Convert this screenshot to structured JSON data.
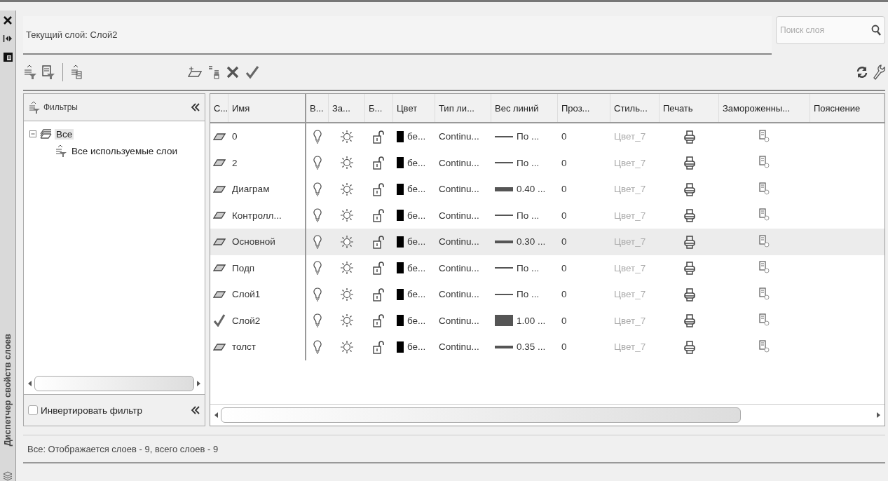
{
  "side_strip": {
    "title": "Диспетчер свойств слоев"
  },
  "current_layer": "Текущий слой: Слой2",
  "search": {
    "placeholder": "Поиск слоя"
  },
  "filters": {
    "title": "Фильтры",
    "tree": [
      {
        "label": "Все",
        "expanded": true,
        "selected": true,
        "children": [
          {
            "label": "Все используемые слои",
            "selected": false
          }
        ]
      }
    ],
    "invert": {
      "label": "Инвертировать фильтр",
      "checked": false
    }
  },
  "table": {
    "columns": [
      "С...",
      "Имя",
      "В...",
      "За...",
      "Б...",
      "Цвет",
      "Тип ли...",
      "Вес линий",
      "Проз...",
      "Стиль...",
      "Печать",
      "Замороженны...",
      "Пояснение"
    ],
    "rows": [
      {
        "current": false,
        "selected": false,
        "name": "0",
        "on": true,
        "frozen": false,
        "locked": false,
        "color": "#000000",
        "color_name": "бе...",
        "linetype": "Continu...",
        "kind": "thin",
        "lineweight": "По ...",
        "transparency": "0",
        "plot_style": "Цвет_7",
        "plot": true
      },
      {
        "current": false,
        "selected": false,
        "name": "2",
        "on": true,
        "frozen": false,
        "locked": false,
        "color": "#000000",
        "color_name": "бе...",
        "linetype": "Continu...",
        "kind": "thin",
        "lineweight": "По ...",
        "transparency": "0",
        "plot_style": "Цвет_7",
        "plot": true
      },
      {
        "current": false,
        "selected": false,
        "name": "Диаграм",
        "on": true,
        "frozen": false,
        "locked": false,
        "color": "#000000",
        "color_name": "бе...",
        "linetype": "Continu...",
        "kind": "bold",
        "lineweight": "0.40 ...",
        "transparency": "0",
        "plot_style": "Цвет_7",
        "plot": true
      },
      {
        "current": false,
        "selected": false,
        "name": "Контролл...",
        "on": true,
        "frozen": false,
        "locked": false,
        "color": "#000000",
        "color_name": "бе...",
        "linetype": "Continu...",
        "kind": "thin",
        "lineweight": "По ...",
        "transparency": "0",
        "plot_style": "Цвет_7",
        "plot": true
      },
      {
        "current": false,
        "selected": true,
        "name": "Основной",
        "on": true,
        "frozen": false,
        "locked": false,
        "color": "#000000",
        "color_name": "бе...",
        "linetype": "Continu...",
        "kind": "medium",
        "lineweight": "0.30 ...",
        "transparency": "0",
        "plot_style": "Цвет_7",
        "plot": true
      },
      {
        "current": false,
        "selected": false,
        "name": "Подп",
        "on": true,
        "frozen": false,
        "locked": false,
        "color": "#000000",
        "color_name": "бе...",
        "linetype": "Continu...",
        "kind": "thin",
        "lineweight": "По ...",
        "transparency": "0",
        "plot_style": "Цвет_7",
        "plot": true
      },
      {
        "current": false,
        "selected": false,
        "name": "Слой1",
        "on": true,
        "frozen": false,
        "locked": false,
        "color": "#000000",
        "color_name": "бе...",
        "linetype": "Continu...",
        "kind": "thin",
        "lineweight": "По ...",
        "transparency": "0",
        "plot_style": "Цвет_7",
        "plot": true
      },
      {
        "current": true,
        "selected": false,
        "name": "Слой2",
        "on": true,
        "frozen": false,
        "locked": false,
        "color": "#000000",
        "color_name": "бе...",
        "linetype": "Continu...",
        "kind": "heavy",
        "lineweight": "1.00 ...",
        "transparency": "0",
        "plot_style": "Цвет_7",
        "plot": true
      },
      {
        "current": false,
        "selected": false,
        "name": "толст",
        "on": true,
        "frozen": false,
        "locked": false,
        "color": "#000000",
        "color_name": "бе...",
        "linetype": "Continu...",
        "kind": "medium",
        "lineweight": "0.35 ...",
        "transparency": "0",
        "plot_style": "Цвет_7",
        "plot": true
      }
    ]
  },
  "status_bar": "Все: Отображается слоев - 9, всего слоев - 9"
}
